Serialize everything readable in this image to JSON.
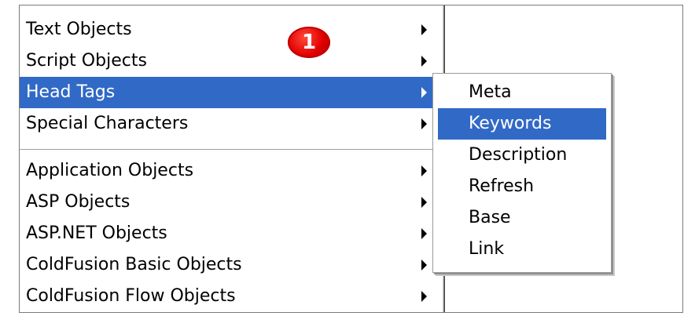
{
  "main_menu": {
    "items": [
      {
        "label": "Text Objects"
      },
      {
        "label": "Script Objects"
      },
      {
        "label": "Head Tags",
        "selected": true
      },
      {
        "label": "Special Characters"
      },
      {
        "label": "Application Objects"
      },
      {
        "label": "ASP Objects"
      },
      {
        "label": "ASP.NET Objects"
      },
      {
        "label": "ColdFusion Basic Objects"
      },
      {
        "label": "ColdFusion Flow Objects"
      }
    ]
  },
  "callout": {
    "number": "1"
  },
  "submenu": {
    "items": [
      {
        "label": "Meta"
      },
      {
        "label": "Keywords",
        "selected": true
      },
      {
        "label": "Description"
      },
      {
        "label": "Refresh"
      },
      {
        "label": "Base"
      },
      {
        "label": "Link"
      }
    ]
  },
  "colors": {
    "selection": "#3169c6",
    "callout": "#e00000"
  }
}
